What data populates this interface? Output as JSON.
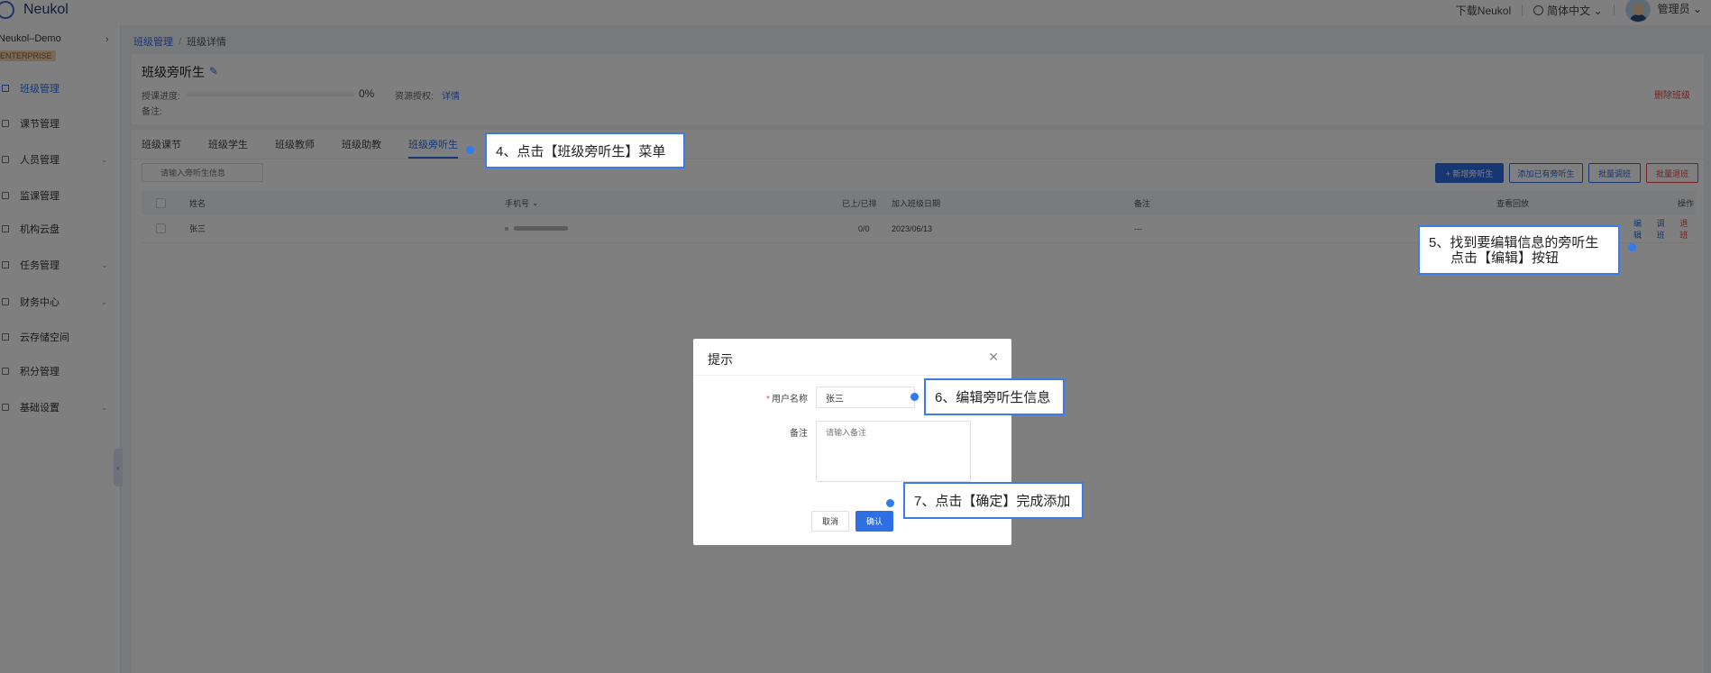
{
  "header": {
    "app_name": "Neukol",
    "download_link": "下载Neukol",
    "language": "简体中文",
    "user": "管理员"
  },
  "sidebar": {
    "org_name": "Neukol–Demo",
    "badge": "ENTERPRISE",
    "items": [
      {
        "label": "班级管理",
        "active": true,
        "expandable": false
      },
      {
        "label": "课节管理",
        "active": false,
        "expandable": false
      },
      {
        "label": "人员管理",
        "active": false,
        "expandable": true
      },
      {
        "label": "监课管理",
        "active": false,
        "expandable": false
      },
      {
        "label": "机构云盘",
        "active": false,
        "expandable": false
      },
      {
        "label": "任务管理",
        "active": false,
        "expandable": true
      },
      {
        "label": "财务中心",
        "active": false,
        "expandable": true
      },
      {
        "label": "云存储空间",
        "active": false,
        "expandable": false
      },
      {
        "label": "积分管理",
        "active": false,
        "expandable": false
      },
      {
        "label": "基础设置",
        "active": false,
        "expandable": true
      }
    ]
  },
  "breadcrumb": {
    "root": "班级管理",
    "current": "班级详情"
  },
  "class_info": {
    "title": "班级旁听生",
    "progress_label": "授课进度:",
    "progress_percent": "0%",
    "progress_value": 0,
    "resource_label": "资源授权:",
    "resource_link": "详情",
    "note_label": "备注:",
    "delete_label": "删除班级"
  },
  "tabs": [
    "班级课节",
    "班级学生",
    "班级教师",
    "班级助教",
    "班级旁听生"
  ],
  "active_tab": 4,
  "search": {
    "placeholder": "请输入旁听生信息"
  },
  "actions": {
    "add_new": "+ 新增旁听生",
    "add_existing": "添加已有旁听生",
    "batch_transfer": "批量调班",
    "batch_remove": "批量退班"
  },
  "table": {
    "columns": {
      "name": "姓名",
      "phone": "手机号",
      "attended": "已上/已排",
      "join_date": "加入班级日期",
      "note": "备注",
      "replay": "查看回放",
      "ops": "操作"
    },
    "rows": [
      {
        "name": "张三",
        "attended": "0/0",
        "join_date": "2023/06/13",
        "note": "---",
        "ops": [
          "编辑",
          "调班",
          "退班"
        ]
      }
    ]
  },
  "dialog": {
    "title": "提示",
    "username_label": "用户名称",
    "username_value": "张三",
    "note_label": "备注",
    "note_placeholder": "请输入备注",
    "cancel": "取消",
    "confirm": "确认"
  },
  "callouts": {
    "step4": "4、点击【班级旁听生】菜单",
    "step5_line1": "5、找到要编辑信息的旁听生",
    "step5_line2": "点击【编辑】按钮",
    "step6": "6、编辑旁听生信息",
    "step7": "7、点击【确定】完成添加"
  },
  "colors": {
    "primary": "#2f6fe4",
    "danger": "#e5484d",
    "callout_border": "#3b7bea"
  }
}
